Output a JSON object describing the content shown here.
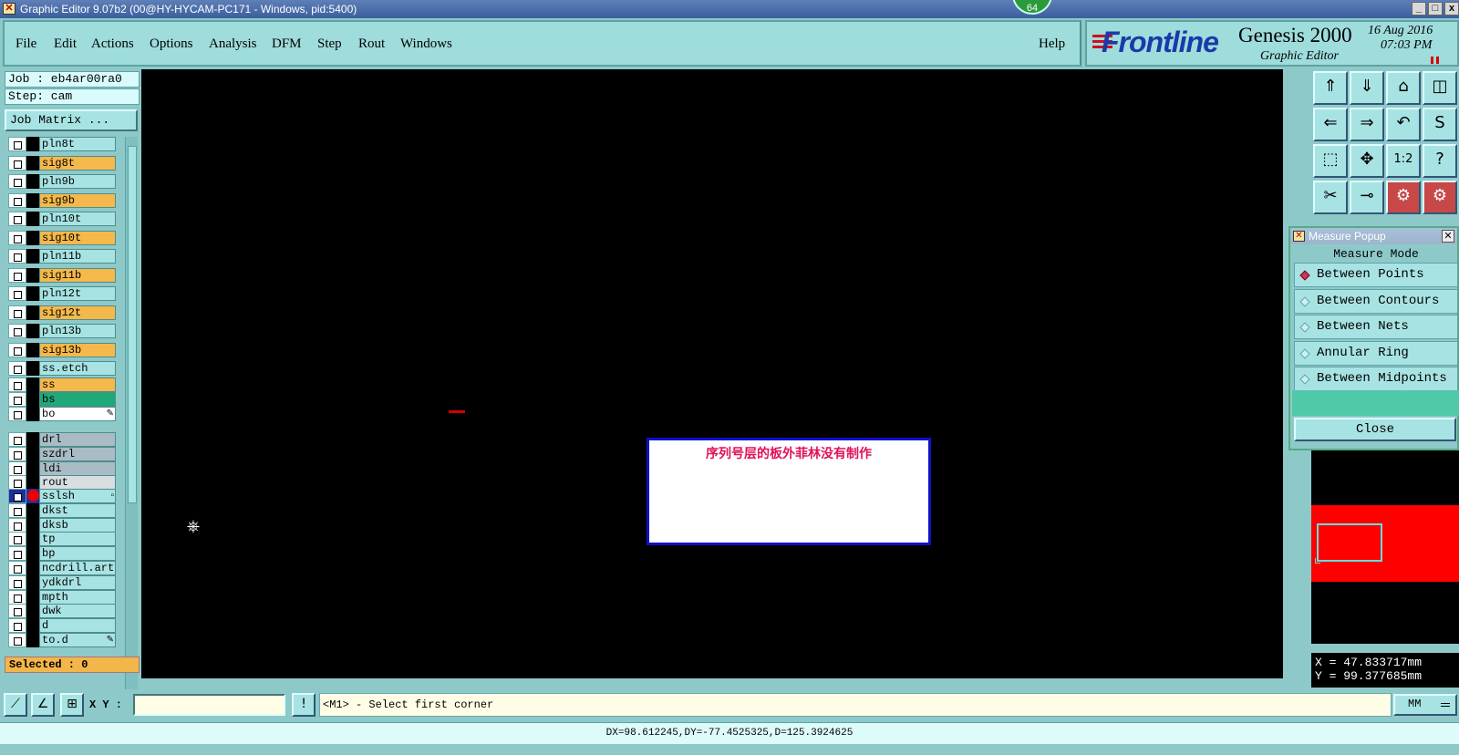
{
  "window": {
    "title": "Graphic Editor 9.07b2 (00@HY-HYCAM-PC171 - Windows, pid:5400)",
    "badge": "64",
    "controls": [
      "_",
      "□",
      "x"
    ]
  },
  "menu": {
    "items": [
      "File",
      "Edit",
      "Actions",
      "Options",
      "Analysis",
      "DFM",
      "Step",
      "Rout",
      "Windows"
    ],
    "help": "Help"
  },
  "brand": {
    "logo": "Frontline",
    "product": "Genesis 2000",
    "subtitle": "Graphic Editor",
    "date": "16 Aug 2016",
    "time": "07:03 PM"
  },
  "job": {
    "job_line": "Job : eb4ar00ra0",
    "step_line": "Step: cam",
    "matrix_button": "Job Matrix ..."
  },
  "layers": [
    {
      "name": "pln8t",
      "color": "#a8e3e3"
    },
    {
      "name": "sig8t",
      "color": "#f5b84a"
    },
    {
      "name": "pln9b",
      "color": "#a8e3e3"
    },
    {
      "name": "sig9b",
      "color": "#f5b84a"
    },
    {
      "name": "pln10t",
      "color": "#a8e3e3"
    },
    {
      "name": "sig10t",
      "color": "#f5b84a"
    },
    {
      "name": "pln11b",
      "color": "#a8e3e3"
    },
    {
      "name": "sig11b",
      "color": "#f5b84a"
    },
    {
      "name": "pln12t",
      "color": "#a8e3e3"
    },
    {
      "name": "sig12t",
      "color": "#f5b84a"
    },
    {
      "name": "pln13b",
      "color": "#a8e3e3"
    },
    {
      "name": "sig13b",
      "color": "#f5b84a"
    },
    {
      "name": "ss.etch",
      "color": "#a8e3e3"
    },
    {
      "name": "ss",
      "color": "#f5b84a"
    },
    {
      "name": "bs",
      "color": "#1fa878"
    },
    {
      "name": "bo",
      "color": "#ffffff",
      "mark": "✎"
    },
    {
      "name": "drl",
      "color": "#a9bcc6"
    },
    {
      "name": "szdrl",
      "color": "#a9bcc6"
    },
    {
      "name": "ldi",
      "color": "#a9bcc6"
    },
    {
      "name": "rout",
      "color": "#d8dde0"
    },
    {
      "name": "sslsh",
      "color": "#a8e3e3",
      "active": true,
      "mark": "▫"
    },
    {
      "name": "dkst",
      "color": "#a8e3e3"
    },
    {
      "name": "dksb",
      "color": "#a8e3e3"
    },
    {
      "name": "tp",
      "color": "#a8e3e3"
    },
    {
      "name": "bp",
      "color": "#a8e3e3"
    },
    {
      "name": "ncdrill.art",
      "color": "#a8e3e3"
    },
    {
      "name": "ydkdrl",
      "color": "#a8e3e3"
    },
    {
      "name": "mpth",
      "color": "#a8e3e3"
    },
    {
      "name": "dwk",
      "color": "#a8e3e3"
    },
    {
      "name": "d",
      "color": "#a8e3e3"
    },
    {
      "name": "to.d",
      "color": "#a8e3e3",
      "mark": "✎"
    }
  ],
  "selected": "Selected : 0",
  "canvas": {
    "note": "序列号层的板外菲林没有制作"
  },
  "toolbar_icons": [
    "zoom-in-top-icon",
    "zoom-in-bottom-icon",
    "home-icon",
    "split-view-icon",
    "pan-left-icon",
    "pan-right-icon",
    "undo-view-icon",
    "pan-s-icon",
    "fit-all-icon",
    "fit-profile-icon",
    "one-to-two-icon",
    "help-icon",
    "tools-icon",
    "probe-icon",
    "net-icon-a",
    "net-icon-b"
  ],
  "measure_popup": {
    "title": "Measure Popup",
    "mode_label": "Measure Mode",
    "options": [
      {
        "label": "Between Points",
        "selected": true
      },
      {
        "label": "Between Contours",
        "selected": false
      },
      {
        "label": "Between Nets",
        "selected": false
      },
      {
        "label": "Annular Ring",
        "selected": false
      },
      {
        "label": "Between Midpoints",
        "selected": false
      }
    ],
    "close_label": "Close"
  },
  "coords": {
    "x_line": "X = 47.833717mm",
    "y_line": "Y = 99.377685mm"
  },
  "bottom": {
    "xy_label": "X Y :",
    "xy_value": "",
    "prompt": "<M1> - Select first corner",
    "units": "MM"
  },
  "status": "DX=98.612245,DY=-77.4525325,D=125.3924625",
  "colors": {
    "panel": "#8ec9c9",
    "accent_orange": "#f5b84a",
    "canvas_bg": "#000000",
    "brand_blue": "#1a3aa8",
    "brand_red": "#d01020"
  }
}
